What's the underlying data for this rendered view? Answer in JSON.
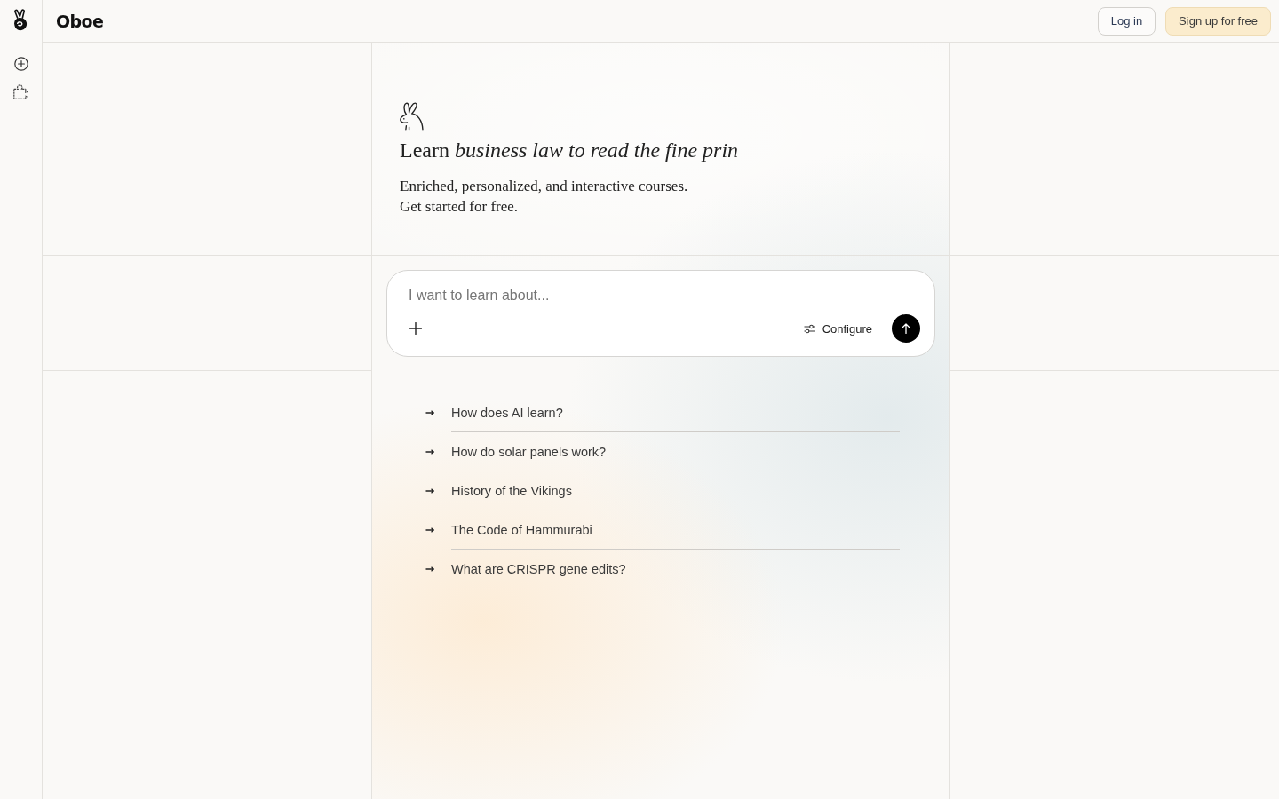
{
  "header": {
    "brand": "Oboe",
    "buttons": [
      {
        "label": "Log in",
        "kind": "outline"
      },
      {
        "label": "Sign up for free",
        "kind": "primary"
      }
    ]
  },
  "hero": {
    "title": "Learn *business law to read the fine prin*",
    "subtitle_lines": [
      "Enriched, personalized, and interactive courses.",
      "Get started for free."
    ]
  },
  "prompt": {
    "placeholder": "I want to learn about...",
    "configure": "Configure"
  },
  "suggestions": [
    "How does AI learn?",
    "How do solar panels work?",
    "History of the Vikings",
    "The Code of Hammurabi",
    "What are CRISPR gene edits?"
  ]
}
